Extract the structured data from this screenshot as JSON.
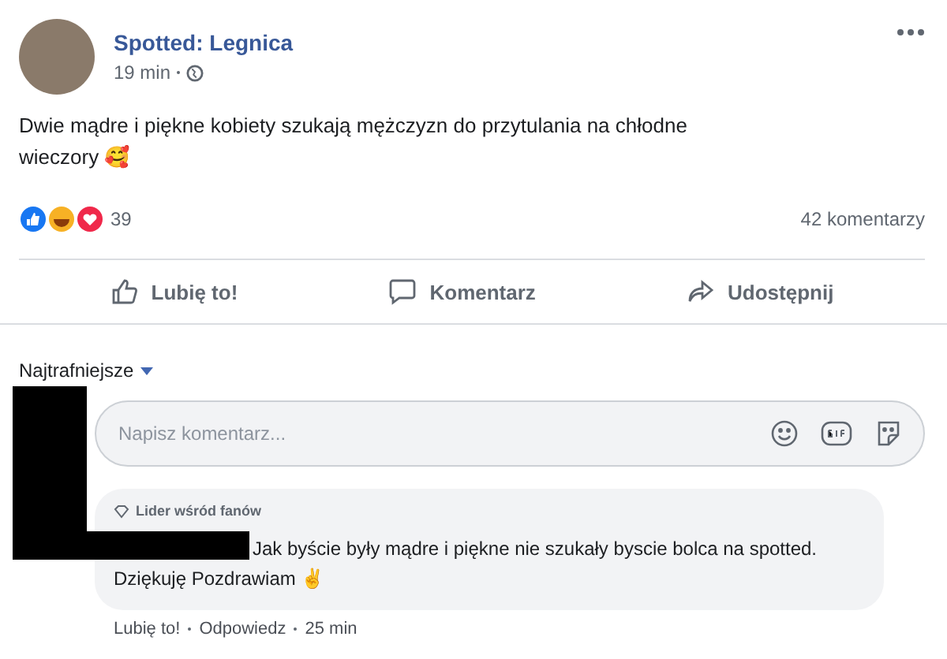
{
  "post": {
    "page_name": "Spotted: Legnica",
    "time": "19 min",
    "text": "Dwie mądre i piękne kobiety szukają mężczyzn do przytulania na chłodne wieczory 🥰",
    "reaction_count": "39",
    "comments_count": "42 komentarzy"
  },
  "actions": [
    {
      "kind": "like",
      "label": "Lubię to!"
    },
    {
      "kind": "comment",
      "label": "Komentarz"
    },
    {
      "kind": "share",
      "label": "Udostępnij"
    }
  ],
  "sort": {
    "label": "Najtrafniejsze"
  },
  "comment_field": {
    "placeholder": "Napisz komentarz..."
  },
  "comment": {
    "badge": "Lider wśród fanów",
    "text": "Jak byście były mądre i piękne nie szukały byscie bolca na spotted. Dziękuję Pozdrawiam ✌",
    "links": [
      "Lubię to!",
      "Odpowiedz",
      "25 min"
    ]
  }
}
